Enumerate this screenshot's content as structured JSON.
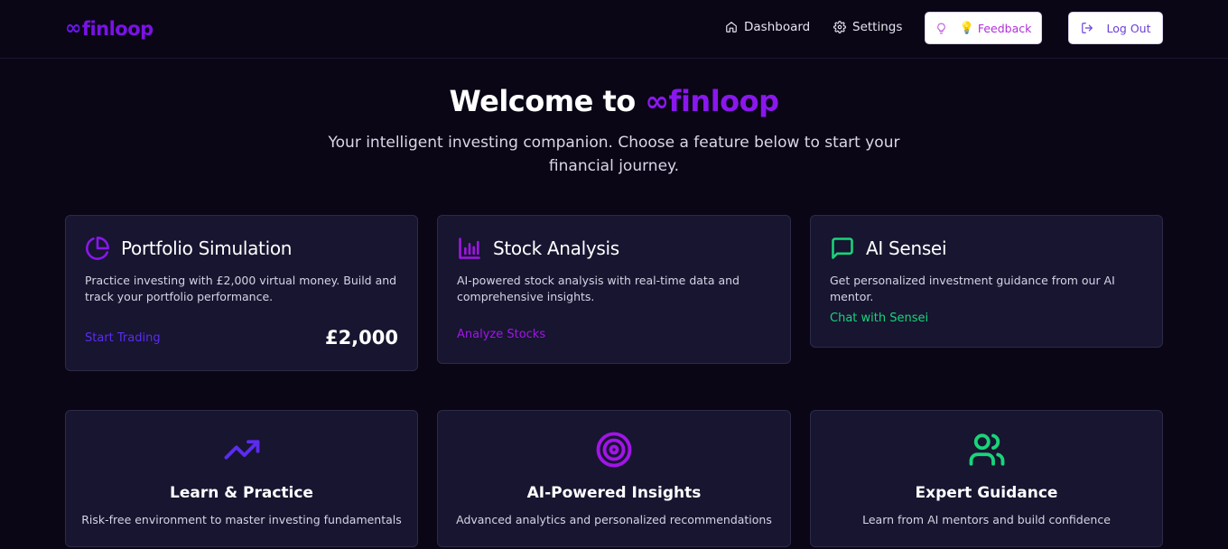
{
  "header": {
    "logo_symbol": "∞",
    "logo_text": "finloop",
    "nav": {
      "dashboard": "Dashboard",
      "settings": "Settings",
      "feedback": "Feedback",
      "logout": "Log Out"
    }
  },
  "hero": {
    "title_prefix": "Welcome to",
    "title_brand_symbol": "∞",
    "title_brand": "finloop",
    "subtitle": "Your intelligent investing companion. Choose a feature below to start your financial journey."
  },
  "cards": [
    {
      "icon": "pie-chart-icon",
      "title": "Portfolio Simulation",
      "description": "Practice investing with £2,000 virtual money. Build and track your portfolio performance.",
      "link": "Start Trading",
      "amount": "£2,000",
      "accent": "#5b2cf0"
    },
    {
      "icon": "bar-chart-icon",
      "title": "Stock Analysis",
      "description": "AI-powered stock analysis with real-time data and comprehensive insights.",
      "link": "Analyze Stocks",
      "accent": "#a214e8"
    },
    {
      "icon": "message-icon",
      "title": "AI Sensei",
      "description": "Get personalized investment guidance from our AI mentor.",
      "link": "Chat with Sensei",
      "accent": "#19d47a"
    }
  ],
  "features": [
    {
      "icon": "trending-up-icon",
      "title": "Learn & Practice",
      "description": "Risk-free environment to master investing fundamentals",
      "accent": "#5b2cf0"
    },
    {
      "icon": "target-icon",
      "title": "AI-Powered Insights",
      "description": "Advanced analytics and personalized recommendations",
      "accent": "#a214e8"
    },
    {
      "icon": "users-icon",
      "title": "Expert Guidance",
      "description": "Learn from AI mentors and build confidence",
      "accent": "#19d47a"
    }
  ],
  "colors": {
    "background": "#0a0616",
    "card": "#171530",
    "brand": "#8a17ee",
    "feedback_text": "#b02fd8",
    "logout_text": "#6a3ed8"
  }
}
